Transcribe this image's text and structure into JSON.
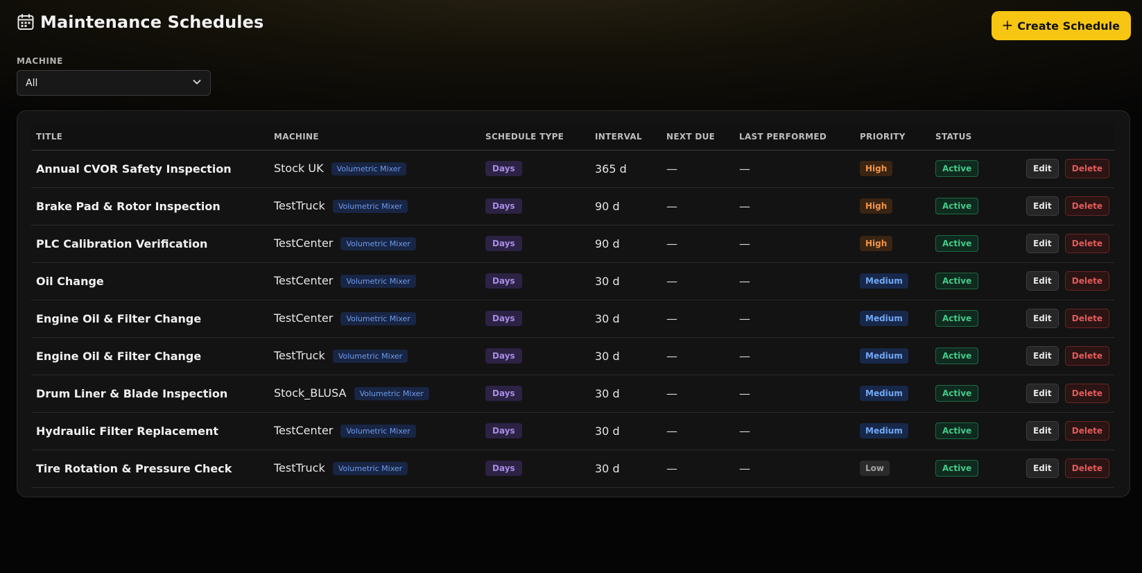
{
  "header": {
    "title": "Maintenance Schedules",
    "title_icon": "calendar-icon",
    "create_button": {
      "icon": "plus-icon",
      "label": "Create Schedule"
    },
    "accent_color": "#f7c612"
  },
  "filter": {
    "label": "MACHINE",
    "selected": "All",
    "icon": "chevron-down-icon"
  },
  "table": {
    "columns": [
      "TITLE",
      "MACHINE",
      "SCHEDULE TYPE",
      "INTERVAL",
      "NEXT DUE",
      "LAST PERFORMED",
      "PRIORITY",
      "STATUS",
      ""
    ],
    "rows": [
      {
        "title": "Annual CVOR Safety Inspection",
        "machine": "Stock UK",
        "machine_type": "Volumetric Mixer",
        "schedule_type": "Days",
        "interval": "365 d",
        "next_due": "—",
        "last_performed": "—",
        "priority": "High",
        "status": "Active",
        "edit": "Edit",
        "delete": "Delete"
      },
      {
        "title": "Brake Pad & Rotor Inspection",
        "machine": "TestTruck",
        "machine_type": "Volumetric Mixer",
        "schedule_type": "Days",
        "interval": "90 d",
        "next_due": "—",
        "last_performed": "—",
        "priority": "High",
        "status": "Active",
        "edit": "Edit",
        "delete": "Delete"
      },
      {
        "title": "PLC Calibration Verification",
        "machine": "TestCenter",
        "machine_type": "Volumetric Mixer",
        "schedule_type": "Days",
        "interval": "90 d",
        "next_due": "—",
        "last_performed": "—",
        "priority": "High",
        "status": "Active",
        "edit": "Edit",
        "delete": "Delete"
      },
      {
        "title": "Oil Change",
        "machine": "TestCenter",
        "machine_type": "Volumetric Mixer",
        "schedule_type": "Days",
        "interval": "30 d",
        "next_due": "—",
        "last_performed": "—",
        "priority": "Medium",
        "status": "Active",
        "edit": "Edit",
        "delete": "Delete"
      },
      {
        "title": "Engine Oil & Filter Change",
        "machine": "TestCenter",
        "machine_type": "Volumetric Mixer",
        "schedule_type": "Days",
        "interval": "30 d",
        "next_due": "—",
        "last_performed": "—",
        "priority": "Medium",
        "status": "Active",
        "edit": "Edit",
        "delete": "Delete"
      },
      {
        "title": "Engine Oil & Filter Change",
        "machine": "TestTruck",
        "machine_type": "Volumetric Mixer",
        "schedule_type": "Days",
        "interval": "30 d",
        "next_due": "—",
        "last_performed": "—",
        "priority": "Medium",
        "status": "Active",
        "edit": "Edit",
        "delete": "Delete"
      },
      {
        "title": "Drum Liner & Blade Inspection",
        "machine": "Stock_BLUSA",
        "machine_type": "Volumetric Mixer",
        "schedule_type": "Days",
        "interval": "30 d",
        "next_due": "—",
        "last_performed": "—",
        "priority": "Medium",
        "status": "Active",
        "edit": "Edit",
        "delete": "Delete"
      },
      {
        "title": "Hydraulic Filter Replacement",
        "machine": "TestCenter",
        "machine_type": "Volumetric Mixer",
        "schedule_type": "Days",
        "interval": "30 d",
        "next_due": "—",
        "last_performed": "—",
        "priority": "Medium",
        "status": "Active",
        "edit": "Edit",
        "delete": "Delete"
      },
      {
        "title": "Tire Rotation & Pressure Check",
        "machine": "TestTruck",
        "machine_type": "Volumetric Mixer",
        "schedule_type": "Days",
        "interval": "30 d",
        "next_due": "—",
        "last_performed": "—",
        "priority": "Low",
        "status": "Active",
        "edit": "Edit",
        "delete": "Delete"
      }
    ]
  }
}
